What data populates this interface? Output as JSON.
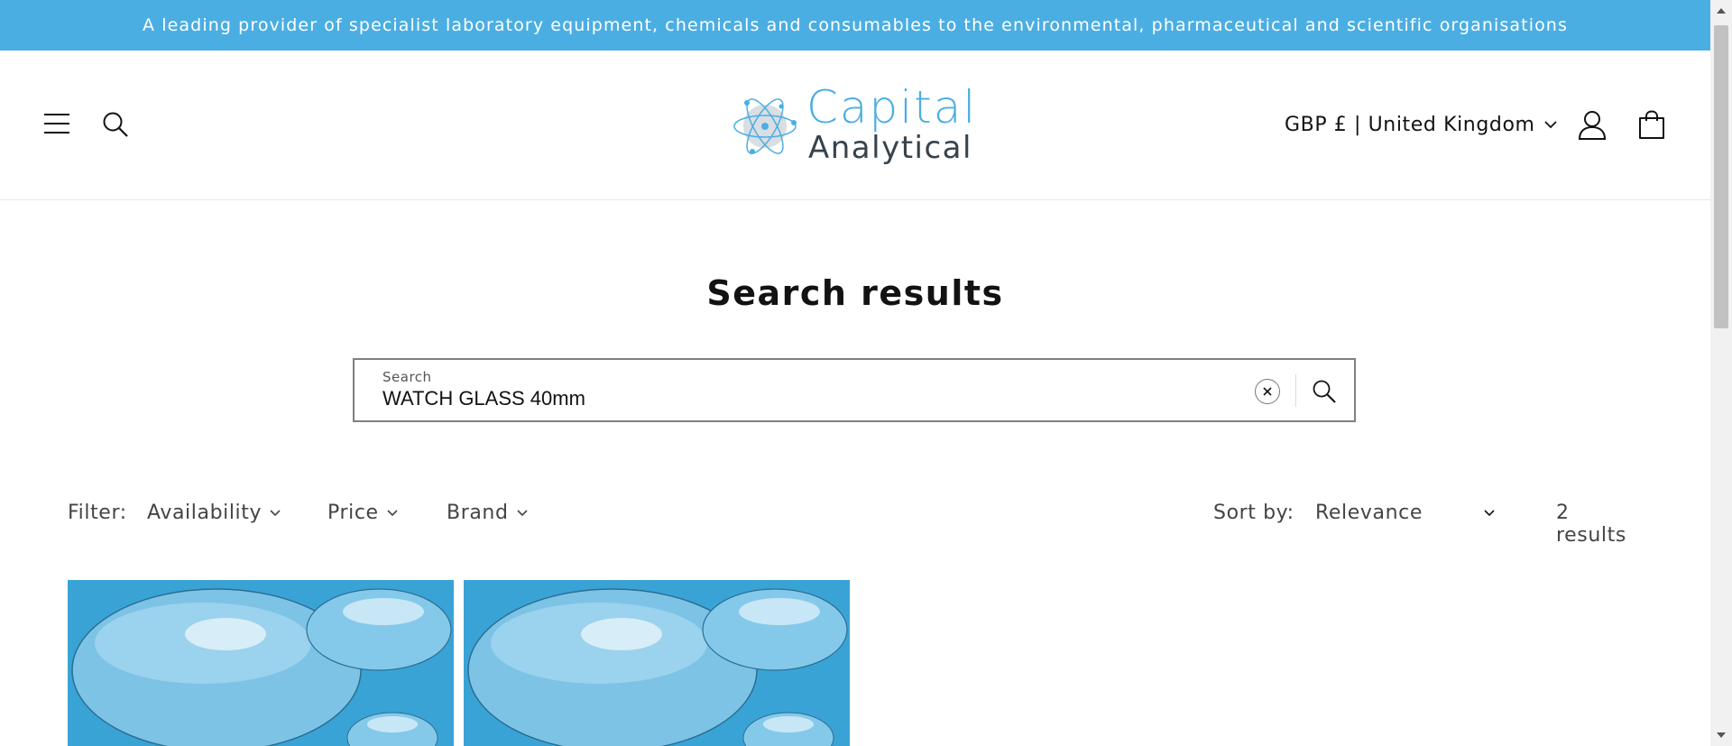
{
  "announcement": {
    "text": "A leading provider of specialist laboratory equipment, chemicals and consumables to the environmental, pharmaceutical and scientific organisations"
  },
  "header": {
    "logo": {
      "line1": "Capital",
      "line2": "Analytical"
    },
    "locale": "GBP £ | United Kingdom",
    "icons": [
      "menu-icon",
      "search-icon",
      "user-icon",
      "cart-icon"
    ]
  },
  "main": {
    "title": "Search results",
    "search": {
      "label": "Search",
      "value": "WATCH GLASS 40mm",
      "placeholder": "Search"
    },
    "filters": {
      "label": "Filter:",
      "items": [
        "Availability",
        "Price",
        "Brand"
      ]
    },
    "sort": {
      "label": "Sort by:",
      "value": "Relevance"
    },
    "result_count": "2 results"
  },
  "colors": {
    "brand_blue": "#4baee3",
    "logo_dark": "#36434d",
    "text": "#121212"
  }
}
